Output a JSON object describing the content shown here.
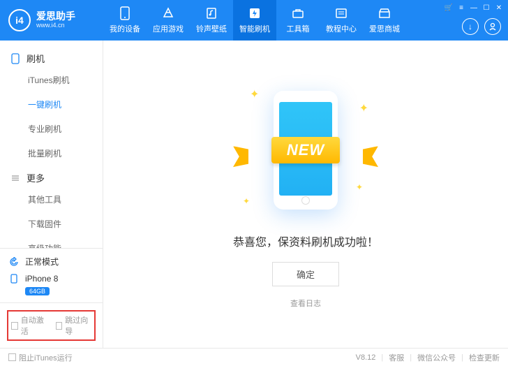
{
  "brand": {
    "name": "爱思助手",
    "url": "www.i4.cn",
    "logo_text": "i4"
  },
  "nav": [
    {
      "label": "我的设备",
      "icon": "phone"
    },
    {
      "label": "应用游戏",
      "icon": "apps"
    },
    {
      "label": "铃声壁纸",
      "icon": "music"
    },
    {
      "label": "智能刷机",
      "icon": "flash",
      "active": true
    },
    {
      "label": "工具箱",
      "icon": "toolbox"
    },
    {
      "label": "教程中心",
      "icon": "book"
    },
    {
      "label": "爱思商城",
      "icon": "store"
    }
  ],
  "sidebar": {
    "sections": [
      {
        "title": "刷机",
        "icon": "phone",
        "items": [
          "iTunes刷机",
          "一键刷机",
          "专业刷机",
          "批量刷机"
        ],
        "active_index": 1
      },
      {
        "title": "更多",
        "icon": "more",
        "items": [
          "其他工具",
          "下载固件",
          "高级功能"
        ]
      }
    ]
  },
  "status": {
    "mode": "正常模式",
    "device": "iPhone 8",
    "storage": "64GB"
  },
  "checkboxes": {
    "auto_activate": "自动激活",
    "skip_guide": "跳过向导"
  },
  "main": {
    "ribbon": "NEW",
    "success": "恭喜您，保资料刷机成功啦！",
    "ok": "确定",
    "log": "查看日志"
  },
  "footer": {
    "block_itunes": "阻止iTunes运行",
    "version": "V8.12",
    "support": "客服",
    "wechat": "微信公众号",
    "update": "检查更新"
  }
}
